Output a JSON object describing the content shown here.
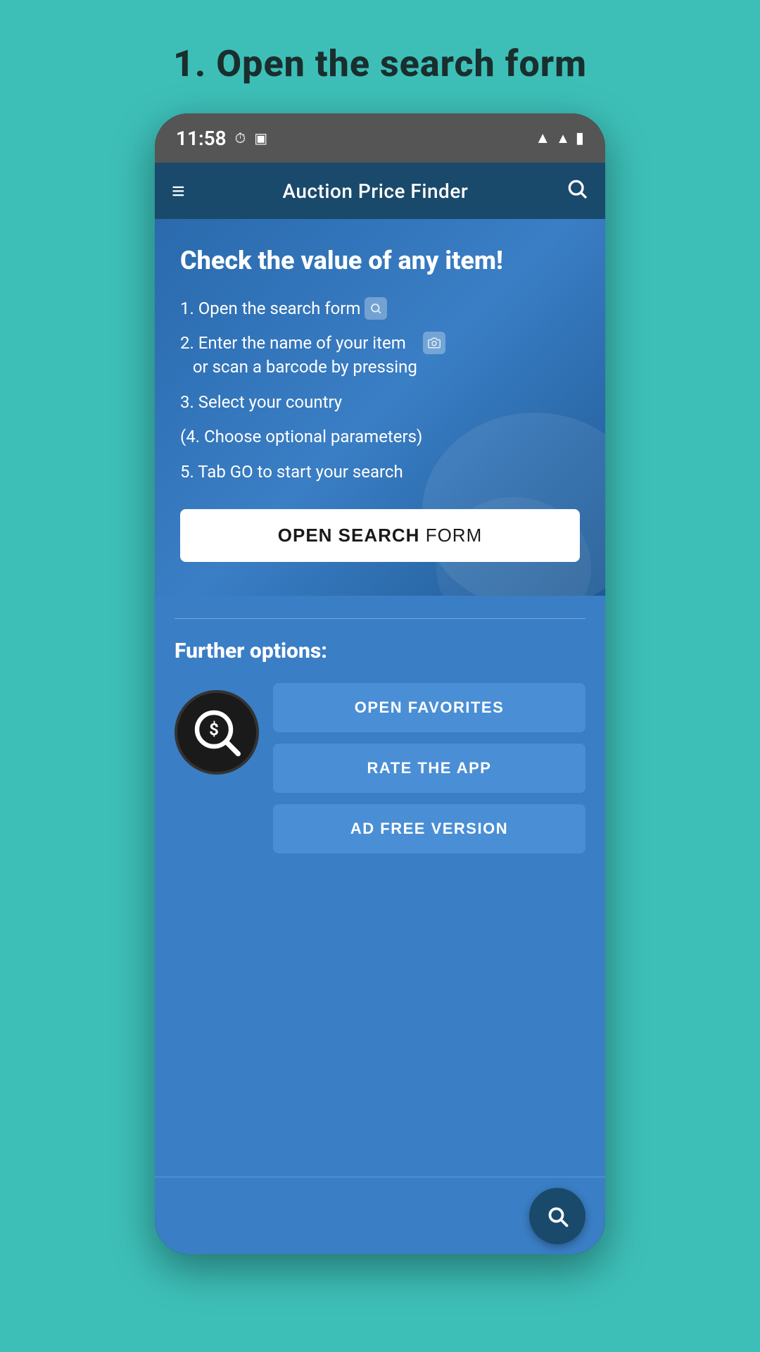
{
  "page": {
    "title": "1. Open the search form",
    "background_color": "#3dbfb8"
  },
  "status_bar": {
    "time": "11:58",
    "icons": [
      "clock-icon",
      "sim-icon"
    ]
  },
  "toolbar": {
    "title": "Auction Price Finder",
    "menu_icon": "≡",
    "search_icon": "🔍"
  },
  "hero": {
    "heading": "Check the value of any item!",
    "instructions": [
      {
        "text": "1. Open the search form",
        "has_search_icon": true
      },
      {
        "text": "2. Enter the name of your item\n   or scan a barcode by pressing",
        "has_camera_icon": true
      },
      {
        "text": "3. Select your country",
        "has_icon": false
      },
      {
        "text": "(4. Choose optional parameters)",
        "has_icon": false
      },
      {
        "text": "5. Tab GO to start your search",
        "has_icon": false
      }
    ],
    "cta_button": {
      "bold": "OPEN SEARCH",
      "light": " FORM"
    }
  },
  "further": {
    "heading": "Further options:",
    "buttons": [
      {
        "label": "OPEN FAVORITES",
        "id": "open-favorites"
      },
      {
        "label": "RATE THE APP",
        "id": "rate-the-app"
      },
      {
        "label": "AD FREE VERSION",
        "id": "ad-free-version"
      }
    ]
  },
  "fab": {
    "icon": "search"
  }
}
